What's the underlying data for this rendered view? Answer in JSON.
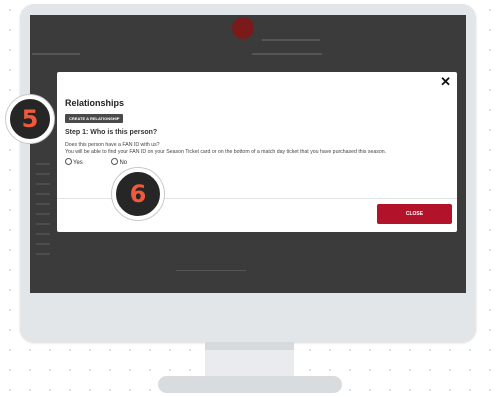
{
  "modal": {
    "close_glyph": "✕",
    "title": "Relationships",
    "create_button": "CREATE A RELATIONSHIP",
    "step_title": "Step 1: Who is this person?",
    "question_line1": "Does this person have a FAN ID with us?",
    "question_line2": "You will be able to find your FAN ID on your Season Ticket card or on the bottom of a match day ticket that you have purchased this season.",
    "option_yes": "Yes",
    "option_no": "No",
    "close_button": "CLOSE"
  },
  "badges": {
    "five": "5",
    "six": "6"
  },
  "colors": {
    "accent": "#b3122b",
    "badge_number": "#f05a3c",
    "badge_bg": "#262626"
  }
}
